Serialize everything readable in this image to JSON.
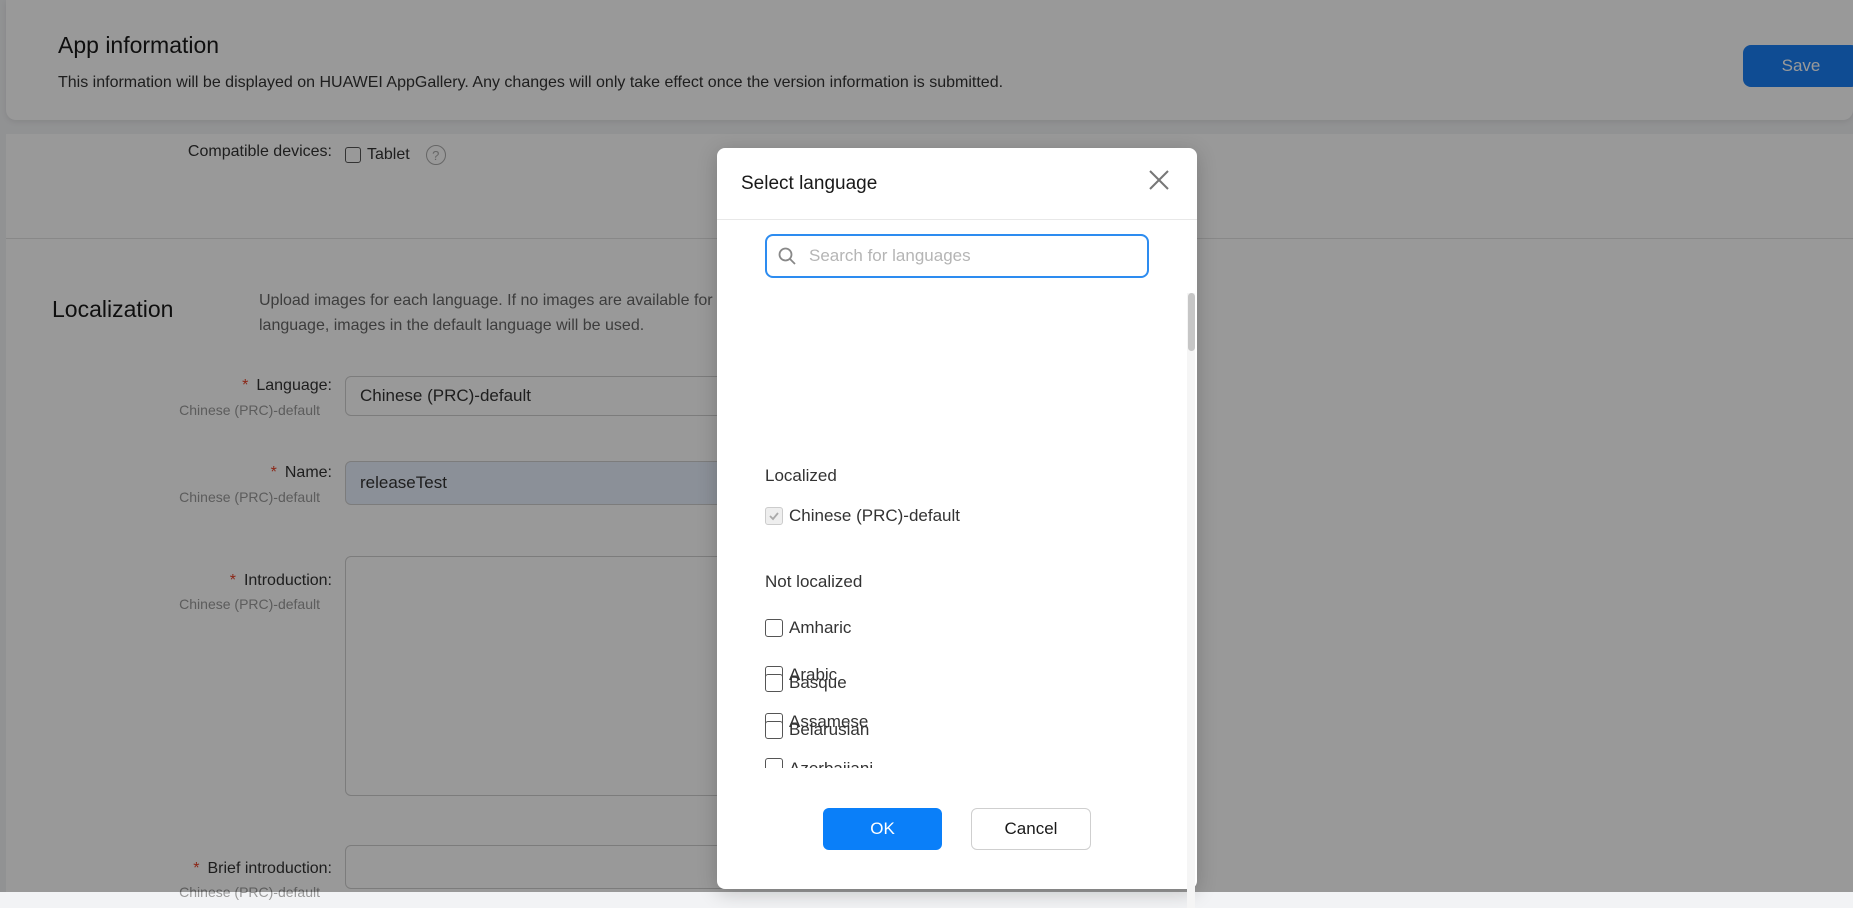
{
  "app_info": {
    "title": "App information",
    "description": "This information will be displayed on HUAWEI AppGallery. Any changes will only take effect once the version information is submitted.",
    "save_label": "Save"
  },
  "compatible": {
    "label": "Compatible devices:",
    "tablet_label": "Tablet",
    "help_icon": "?"
  },
  "localization": {
    "title": "Localization",
    "description": "Upload images for each language. If no images are available for a language, images in the default language will be used.",
    "language_label": "Language:",
    "language_sub": "Chinese (PRC)-default",
    "language_value": "Chinese (PRC)-default",
    "name_label": "Name:",
    "name_sub": "Chinese (PRC)-default",
    "name_value": "releaseTest",
    "intro_label": "Introduction:",
    "intro_sub": "Chinese (PRC)-default",
    "brief_label": "Brief introduction:",
    "brief_sub": "Chinese (PRC)-default",
    "required_mark": "*"
  },
  "dialog": {
    "title": "Select language",
    "search_placeholder": "Search for languages",
    "localized_heading": "Localized",
    "localized_items": [
      "Chinese (PRC)-default"
    ],
    "not_localized_heading": "Not localized",
    "not_localized_items": [
      "Amharic",
      "Arabic",
      "Assamese",
      "Azerbaijani",
      "Basque",
      "Belarusian"
    ],
    "ok_label": "OK",
    "cancel_label": "Cancel"
  },
  "colors": {
    "primary": "#0a7ff9",
    "required": "#e84026",
    "overlay": "rgba(0,0,0,0.4)"
  }
}
